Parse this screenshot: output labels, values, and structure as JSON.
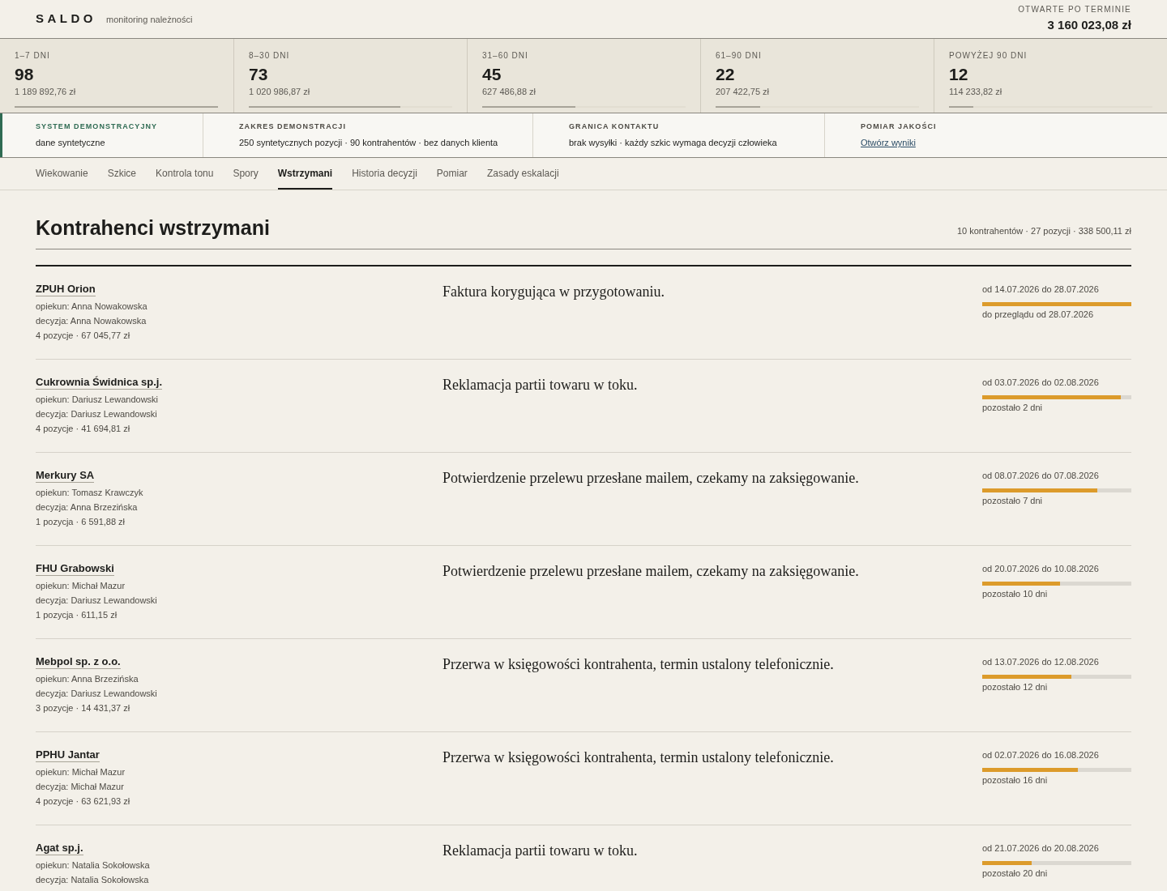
{
  "header": {
    "logo": "SALDO",
    "subtitle": "monitoring należności",
    "total_label": "OTWARTE PO TERMINIE",
    "total_value": "3 160 023,08 zł"
  },
  "buckets": [
    {
      "label": "1–7 DNI",
      "count": "98",
      "amount": "1 189 892,76 zł",
      "level": 1
    },
    {
      "label": "8–30 DNI",
      "count": "73",
      "amount": "1 020 986,87 zł",
      "level": 0.745
    },
    {
      "label": "31–60 DNI",
      "count": "45",
      "amount": "627 486,88 zł",
      "level": 0.46
    },
    {
      "label": "61–90 DNI",
      "count": "22",
      "amount": "207 422,75 zł",
      "level": 0.22
    },
    {
      "label": "POWYŻEJ 90 DNI",
      "count": "12",
      "amount": "114 233,82 zł",
      "level": 0.12
    }
  ],
  "info_strip": [
    {
      "kind": "highlight",
      "label": "SYSTEM DEMONSTRACYJNY",
      "value": "dane syntetyczne"
    },
    {
      "kind": "text",
      "label": "ZAKRES DEMONSTRACJI",
      "value": "250 syntetycznych pozycji · 90 kontrahentów · bez danych klienta"
    },
    {
      "kind": "text",
      "label": "GRANICA KONTAKTU",
      "value": "brak wysyłki · każdy szkic wymaga decyzji człowieka"
    },
    {
      "kind": "link",
      "label": "POMIAR JAKOŚCI",
      "value": "Otwórz wyniki"
    }
  ],
  "tabs": [
    {
      "label": "Wiekowanie",
      "selected": false
    },
    {
      "label": "Szkice",
      "selected": false
    },
    {
      "label": "Kontrola tonu",
      "selected": false
    },
    {
      "label": "Spory",
      "selected": false
    },
    {
      "label": "Wstrzymani",
      "selected": true
    },
    {
      "label": "Historia decyzji",
      "selected": false
    },
    {
      "label": "Pomiar",
      "selected": false
    },
    {
      "label": "Zasady eskalacji",
      "selected": false
    }
  ],
  "section": {
    "title": "Kontrahenci wstrzymani",
    "summary": "10 kontrahentów · 27 pozycji · 338 500,11 zł"
  },
  "rows": [
    {
      "name": "ZPUH Orion",
      "owner": "opiekun: Anna Nowakowska",
      "decision": "decyzja: Anna Nowakowska",
      "items": "4 pozycje · 67 045,77 zł",
      "reason": "Faktura korygująca w przygotowaniu.",
      "period": "od 14.07.2026 do 28.07.2026",
      "level": 1,
      "remaining": "do przeglądu od 28.07.2026"
    },
    {
      "name": "Cukrownia Świdnica sp.j.",
      "owner": "opiekun: Dariusz Lewandowski",
      "decision": "decyzja: Dariusz Lewandowski",
      "items": "4 pozycje · 41 694,81 zł",
      "reason": "Reklamacja partii towaru w toku.",
      "period": "od 03.07.2026 do 02.08.2026",
      "level": 0.93,
      "remaining": "pozostało 2 dni"
    },
    {
      "name": "Merkury SA",
      "owner": "opiekun: Tomasz Krawczyk",
      "decision": "decyzja: Anna Brzezińska",
      "items": "1 pozycja · 6 591,88 zł",
      "reason": "Potwierdzenie przelewu przesłane mailem, czekamy na zaksięgowanie.",
      "period": "od 08.07.2026 do 07.08.2026",
      "level": 0.77,
      "remaining": "pozostało 7 dni"
    },
    {
      "name": "FHU Grabowski",
      "owner": "opiekun: Michał Mazur",
      "decision": "decyzja: Dariusz Lewandowski",
      "items": "1 pozycja · 611,15 zł",
      "reason": "Potwierdzenie przelewu przesłane mailem, czekamy na zaksięgowanie.",
      "period": "od 20.07.2026 do 10.08.2026",
      "level": 0.52,
      "remaining": "pozostało 10 dni"
    },
    {
      "name": "Mebpol sp. z o.o.",
      "owner": "opiekun: Anna Brzezińska",
      "decision": "decyzja: Dariusz Lewandowski",
      "items": "3 pozycje · 14 431,37 zł",
      "reason": "Przerwa w księgowości kontrahenta, termin ustalony telefonicznie.",
      "period": "od 13.07.2026 do 12.08.2026",
      "level": 0.6,
      "remaining": "pozostało 12 dni"
    },
    {
      "name": "PPHU Jantar",
      "owner": "opiekun: Michał Mazur",
      "decision": "decyzja: Michał Mazur",
      "items": "4 pozycje · 63 621,93 zł",
      "reason": "Przerwa w księgowości kontrahenta, termin ustalony telefonicznie.",
      "period": "od 02.07.2026 do 16.08.2026",
      "level": 0.64,
      "remaining": "pozostało 16 dni"
    },
    {
      "name": "Agat sp.j.",
      "owner": "opiekun: Natalia Sokołowska",
      "decision": "decyzja: Natalia Sokołowska",
      "reason": "Reklamacja partii towaru w toku.",
      "period": "od 21.07.2026 do 20.08.2026",
      "level": 0.33,
      "remaining": "pozostało 20 dni"
    }
  ]
}
